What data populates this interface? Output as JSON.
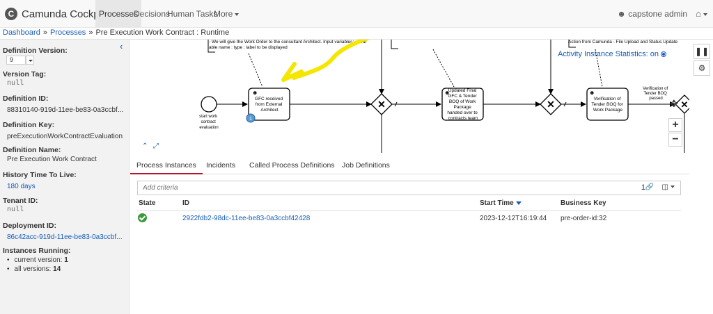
{
  "app": {
    "brand": "Camunda Cockpit",
    "logo_letter": "C"
  },
  "nav": {
    "items": [
      "Processes",
      "Decisions",
      "Human Tasks",
      "More"
    ],
    "active": "Processes",
    "user": "capstone admin"
  },
  "breadcrumb": {
    "items": [
      "Dashboard",
      "Processes",
      "Pre Execution Work Contract : Runtime"
    ],
    "separator": "»"
  },
  "sidebar": {
    "definition_version": {
      "label": "Definition Version:",
      "value": "9"
    },
    "version_tag": {
      "label": "Version Tag:",
      "value": "null"
    },
    "definition_id": {
      "label": "Definition ID:",
      "value": "88310140-919d-11ee-be83-0a3ccbf..."
    },
    "definition_key": {
      "label": "Definition Key:",
      "value": "preExecutionWorkContractEvaluation"
    },
    "definition_name": {
      "label": "Definition Name:",
      "value": "Pre Execution Work Contract"
    },
    "history_ttl": {
      "label": "History Time To Live:",
      "value": "180 days"
    },
    "tenant_id": {
      "label": "Tenant ID:",
      "value": "null"
    },
    "deployment_id": {
      "label": "Deployment ID:",
      "value": "86c42acc-919d-11ee-be83-0a3ccbf..."
    },
    "instances_running": {
      "label": "Instances Running:",
      "current_label": "current version:",
      "current_value": "1",
      "all_label": "all versions:",
      "all_value": "14"
    }
  },
  "diagram": {
    "stats_label": "Activity Instance Statistics: on",
    "annotations": {
      "left": [
        "- We will give the Work Order to the consultant Architect. Input variables: a) var",
        "able name : type : label to be displayed"
      ],
      "right": "Action from Camunda - File Upload and Status Update"
    },
    "start_event": [
      "start work",
      "contract",
      "evaluation"
    ],
    "tasks": {
      "gfc": [
        "GFC received",
        "from External",
        "Architect"
      ],
      "boq": [
        "Updated Final",
        "GFC & Tender",
        "BOQ of Work",
        "Package",
        "handed over to",
        "contracts team"
      ],
      "verification": [
        "Verification of",
        "Tender BOQ for",
        "Work Package"
      ]
    },
    "flow_label": [
      "Verification of",
      "Tender BOQ",
      "passed"
    ],
    "token_count": "1",
    "highlight_color": "#f5e600"
  },
  "tabs": [
    "Process Instances",
    "Incidents",
    "Called Process Definitions",
    "Job Definitions"
  ],
  "active_tab": "Process Instances",
  "criteria": {
    "placeholder": "Add criteria",
    "count": "1"
  },
  "table": {
    "headers": [
      "State",
      "ID",
      "Start Time",
      "Business Key"
    ],
    "rows": [
      {
        "state": "ok",
        "id": "2922fdb2-98dc-11ee-be83-0a3ccbf42428",
        "start_time": "2023-12-12T16:19:44",
        "business_key": "pre-order-id:32"
      }
    ]
  },
  "colors": {
    "link": "#155cb5",
    "active_tab": "#b5152b",
    "ok": "#3c9a3c",
    "sidebar": "#f2f2f2"
  }
}
